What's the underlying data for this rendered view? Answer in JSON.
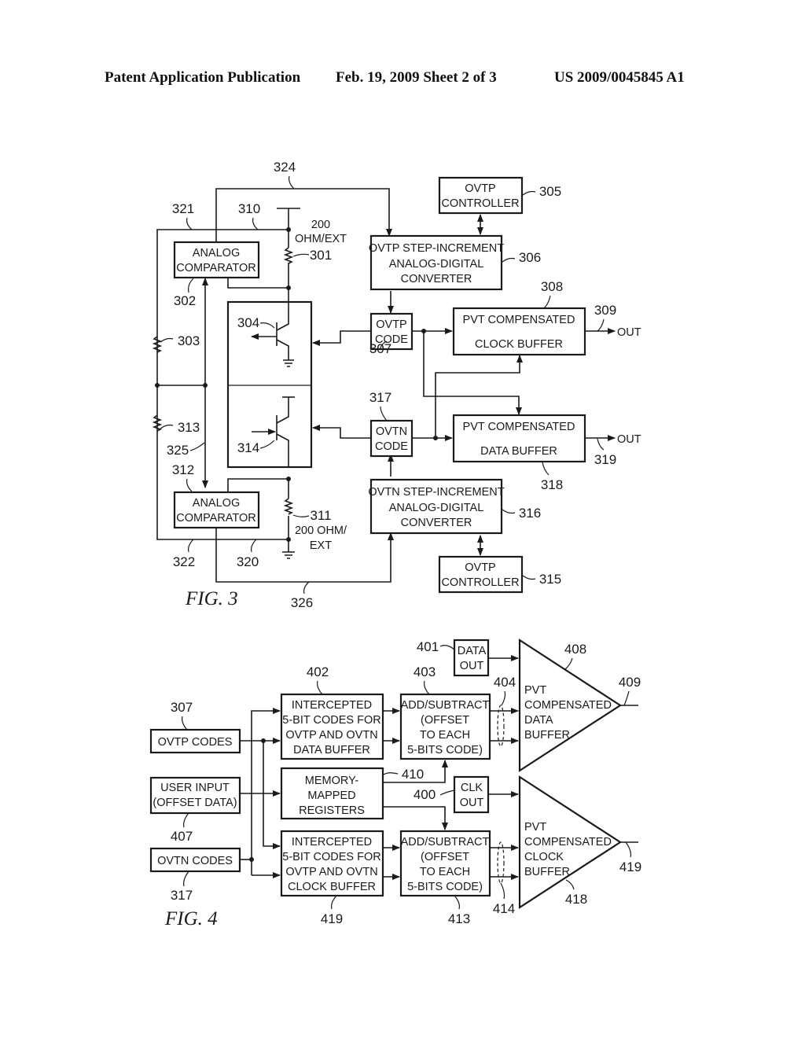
{
  "header": {
    "publication": "Patent Application Publication",
    "date_sheet": "Feb. 19, 2009   Sheet 2 of 3",
    "number": "US 2009/0045845 A1"
  },
  "fig3": {
    "caption": "FIG. 3",
    "comparator_top": [
      "ANALOG",
      "COMPARATOR"
    ],
    "comparator_bottom": [
      "ANALOG",
      "COMPARATOR"
    ],
    "resistor_top_label": [
      "200",
      "OHM/EXT"
    ],
    "resistor_bottom_label": [
      "200 OHM/",
      "EXT"
    ],
    "ovtp_controller_top": [
      "OVTP",
      "CONTROLLER"
    ],
    "ovtp_controller_bottom": [
      "OVTP",
      "CONTROLLER"
    ],
    "ovtp_adc": [
      "OVTP STEP-INCREMENT",
      "ANALOG-DIGITAL",
      "CONVERTER"
    ],
    "ovtn_adc": [
      "OVTN STEP-INCREMENT",
      "ANALOG-DIGITAL",
      "CONVERTER"
    ],
    "ovtp_code": [
      "OVTP",
      "CODE"
    ],
    "ovtn_code": [
      "OVTN",
      "CODE"
    ],
    "clock_buffer": [
      "PVT COMPENSATED",
      "CLOCK BUFFER"
    ],
    "data_buffer": [
      "PVT COMPENSATED",
      "DATA BUFFER"
    ],
    "out_top": "OUT",
    "out_bottom": "OUT",
    "refs": {
      "r324": "324",
      "r321": "321",
      "r310": "310",
      "r301": "301",
      "r302": "302",
      "r305": "305",
      "r306": "306",
      "r308": "308",
      "r309": "309",
      "r304": "304",
      "r303": "303",
      "r307": "307",
      "r317": "317",
      "r313": "313",
      "r314": "314",
      "r325": "325",
      "r312": "312",
      "r318": "318",
      "r319": "319",
      "r311": "311",
      "r316": "316",
      "r322": "322",
      "r320": "320",
      "r315": "315",
      "r326": "326"
    }
  },
  "fig4": {
    "caption": "FIG. 4",
    "ovtp_codes": "OVTP CODES",
    "user_input": [
      "USER INPUT",
      "(OFFSET DATA)"
    ],
    "ovtn_codes": "OVTN CODES",
    "intercepted_data": [
      "INTERCEPTED",
      "5-BIT CODES FOR",
      "OVTP AND OVTN",
      "DATA BUFFER"
    ],
    "memory_mapped": [
      "MEMORY-",
      "MAPPED",
      "REGISTERS"
    ],
    "intercepted_clock": [
      "INTERCEPTED",
      "5-BIT CODES FOR",
      "OVTP AND OVTN",
      "CLOCK BUFFER"
    ],
    "add_subtract_top": [
      "ADD/SUBTRACT",
      "(OFFSET",
      "TO EACH",
      "5-BITS CODE)"
    ],
    "add_subtract_bottom": [
      "ADD/SUBTRACT",
      "(OFFSET",
      "TO EACH",
      "5-BITS CODE)"
    ],
    "data_out": [
      "DATA",
      "OUT"
    ],
    "clk_out": [
      "CLK",
      "OUT"
    ],
    "data_buffer": [
      "PVT",
      "COMPENSATED",
      "DATA",
      "BUFFER"
    ],
    "clock_buffer": [
      "PVT",
      "COMPENSATED",
      "CLOCK",
      "BUFFER"
    ],
    "refs": {
      "r307": "307",
      "r407": "407",
      "r317": "317",
      "r402": "402",
      "r403": "403",
      "r401": "401",
      "r404": "404",
      "r408": "408",
      "r409": "409",
      "r410": "410",
      "r400": "400",
      "r419a": "419",
      "r413": "413",
      "r414": "414",
      "r418": "418",
      "r419b": "419"
    }
  }
}
